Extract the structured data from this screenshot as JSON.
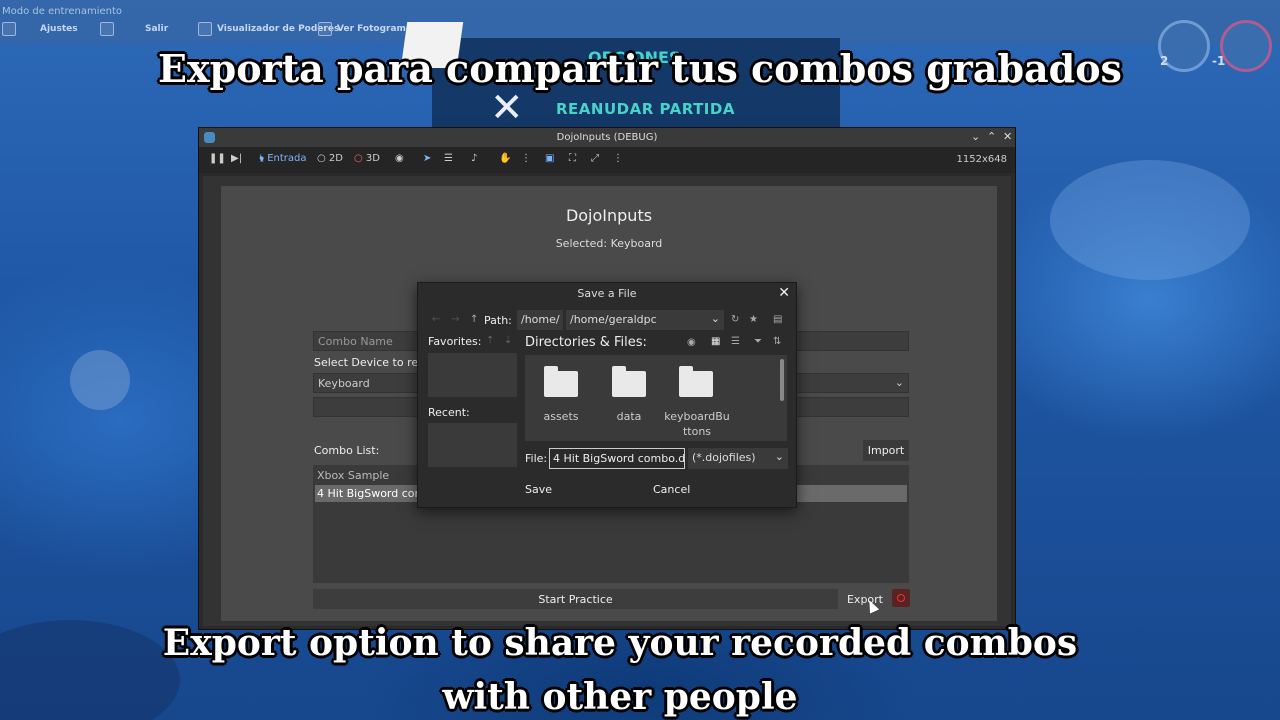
{
  "subtitles": {
    "top": "Exporta para compartir tus combos grabados",
    "bottom_line1": "Export option to share your recorded combos",
    "bottom_line2": "with other people"
  },
  "game": {
    "mode_label": "Modo de entrenamiento",
    "menu": [
      "Ajustes",
      "Salir",
      "Visualizador de Poderes",
      "Ver Fotogramas"
    ],
    "pause_title": "OPCIONES",
    "resume": "REANUDAR PARTIDA",
    "score_left": "2",
    "score_right": "-1"
  },
  "window": {
    "title": "DojoInputs (DEBUG)",
    "toolbar": {
      "entrada": "Entrada",
      "two_d": "2D",
      "three_d": "3D",
      "size": "1152x648"
    }
  },
  "app": {
    "title": "DojoInputs",
    "selected": "Selected: Keyboard",
    "combo_name_placeholder": "Combo Name",
    "select_device_label": "Select Device to reco",
    "device_value": "Keyboard",
    "combo_list_label": "Combo List:",
    "import": "Import",
    "combos": [
      "Xbox Sample",
      "4 Hit BigSword com"
    ],
    "start_practice": "Start Practice",
    "export": "Export"
  },
  "dialog": {
    "title": "Save a File",
    "path_label": "Path:",
    "path_root": "/home/",
    "path_value": "/home/geraldpc",
    "favorites": "Favorites:",
    "recent": "Recent:",
    "dirs_label": "Directories & Files:",
    "folders": [
      "assets",
      "data",
      "keyboardBu ttons"
    ],
    "file_label": "File:",
    "file_value": "4 Hit BigSword combo.d",
    "filter": "(*.dojofiles)",
    "save": "Save",
    "cancel": "Cancel"
  }
}
